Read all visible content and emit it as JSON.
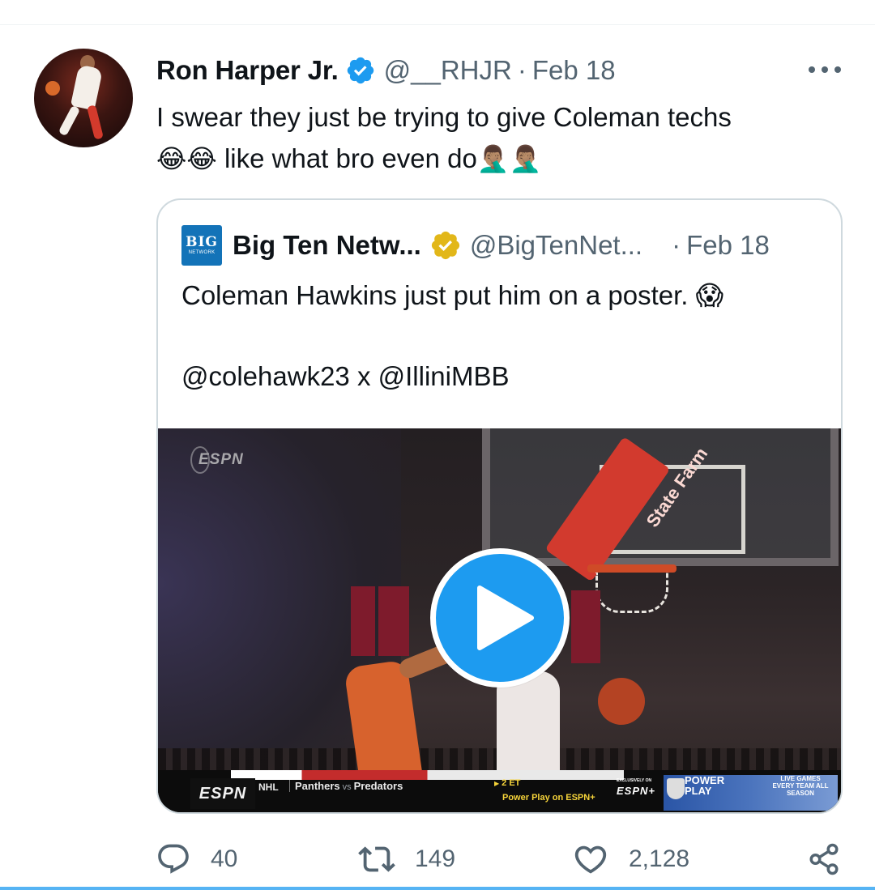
{
  "tweet": {
    "author": {
      "display_name": "Ron Harper Jr.",
      "handle": "@__RHJR",
      "verified": true
    },
    "separator": "·",
    "date": "Feb 18",
    "text_line1": "I swear they just be trying to give Coleman techs",
    "text_line2_emoji_a": "😂😂",
    "text_line2": " like what bro even do",
    "text_line2_emoji_b": "🤦🏽‍♂️🤦🏽‍♂️",
    "more_icon": "more-horizontal-icon"
  },
  "quoted_tweet": {
    "logo_line1": "BIG",
    "logo_line2": "NETWORK",
    "display_name": "Big Ten Netw...",
    "handle": "@BigTenNet...",
    "verified_color": "#e2b719",
    "separator": "·",
    "date": "Feb 18",
    "text": "Coleman Hawkins just put him on a poster. 😱\n\n@colehawk23 x @IlliniMBB",
    "video": {
      "watermark": "ESPN",
      "statefarm": "State Farm",
      "ticker": {
        "network": "ESPN",
        "league": "NHL",
        "team1": "Panthers",
        "vs": "vs",
        "team2": "Predators",
        "time": "2 ET",
        "power_play_text": "Power Play on ESPN+",
        "exclusive": "EXCLUSIVELY ON",
        "exclusive_brand": "ESPN+",
        "power_play_label_1": "POWER",
        "power_play_label_2": "PLAY",
        "live_games": "LIVE GAMES EVERY TEAM ALL SEASON"
      },
      "play_icon": "play-icon"
    }
  },
  "actions": {
    "reply_count": "40",
    "retweet_count": "149",
    "like_count": "2,128"
  },
  "colors": {
    "accent": "#1d9bf0",
    "muted": "#536471",
    "border": "#cfd9de"
  }
}
